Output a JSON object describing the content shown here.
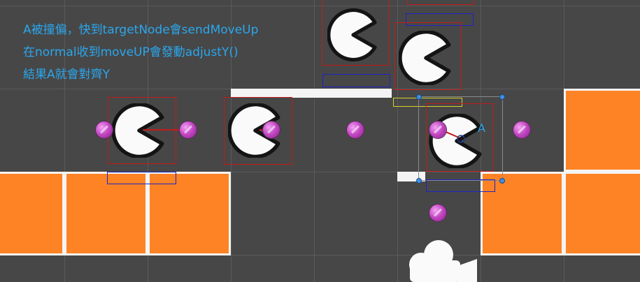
{
  "annotation": {
    "line1": "A被撞偏，快到targetNode會sendMoveUp",
    "line2": "在normal收到moveUP會發動adjustY()",
    "line3": "結果A就會對齊Y"
  },
  "scene_labels": {
    "node_a": "A"
  },
  "colors": {
    "background": "#474747",
    "grid": "#5a5a5a",
    "tile_fill": "#fd8325",
    "tile_border": "#f4f4f4",
    "collider_red": "#c41a1a",
    "collider_blue": "#1f23c7",
    "collider_yellow": "#d8d22a",
    "orb": "#c54ac5",
    "text_annotation": "#2aa7ee"
  },
  "icons": {
    "character": "pacman-sprite-icon",
    "waypoint": "magenta-orb-icon",
    "camera": "scene-camera-gizmo-icon",
    "handle": "rect-transform-handle-icon"
  }
}
